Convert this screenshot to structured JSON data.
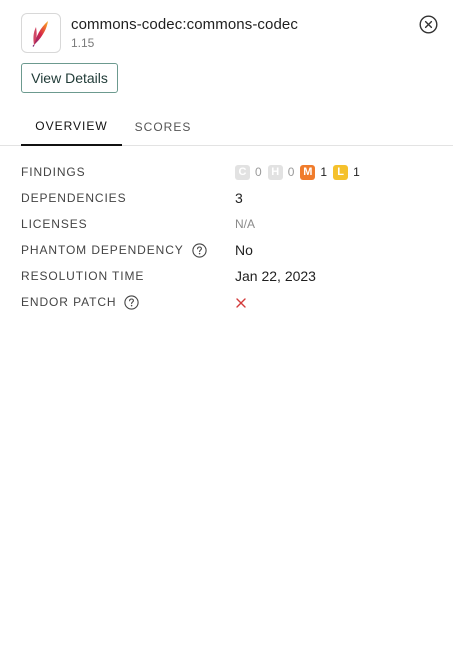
{
  "package": {
    "name": "commons-codec:commons-codec",
    "version": "1.15",
    "logo_icon": "apache-feather-icon"
  },
  "actions": {
    "view_details_label": "View Details",
    "close_icon": "close-circle-icon"
  },
  "tabs": [
    {
      "label": "OVERVIEW",
      "active": true
    },
    {
      "label": "SCORES",
      "active": false
    }
  ],
  "overview": {
    "findings": {
      "label": "FINDINGS",
      "critical": {
        "letter": "C",
        "count": "0",
        "color": "#e2e2e2"
      },
      "high": {
        "letter": "H",
        "count": "0",
        "color": "#e2e2e2"
      },
      "medium": {
        "letter": "M",
        "count": "1",
        "color": "#f07c2c"
      },
      "low": {
        "letter": "L",
        "count": "1",
        "color": "#f5c12c"
      }
    },
    "dependencies": {
      "label": "DEPENDENCIES",
      "value": "3"
    },
    "licenses": {
      "label": "LICENSES",
      "value": "N/A"
    },
    "phantom_dependency": {
      "label": "PHANTOM DEPENDENCY",
      "value": "No",
      "help_icon": "question-circle-icon"
    },
    "resolution_time": {
      "label": "RESOLUTION TIME",
      "value": "Jan 22, 2023"
    },
    "endor_patch": {
      "label": "ENDOR PATCH",
      "value_icon": "x-icon",
      "help_icon": "question-circle-icon",
      "icon_color": "#d33a3a"
    }
  }
}
